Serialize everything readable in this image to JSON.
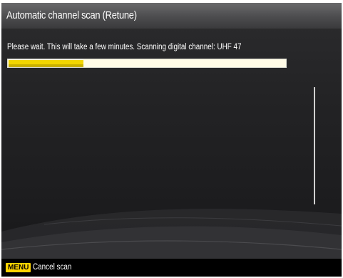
{
  "window": {
    "title": "Automatic channel scan (Retune)"
  },
  "scan": {
    "status_message": "Please wait. This will take a few minutes. Scanning digital channel: UHF 47",
    "progress_fraction": 0.27
  },
  "footer": {
    "menu_key": "MENU",
    "menu_action": "Cancel scan"
  },
  "colors": {
    "accent_yellow": "#f2d500",
    "progress_track": "#fffbe6",
    "background": "#1f1f21",
    "footer": "#000000"
  }
}
